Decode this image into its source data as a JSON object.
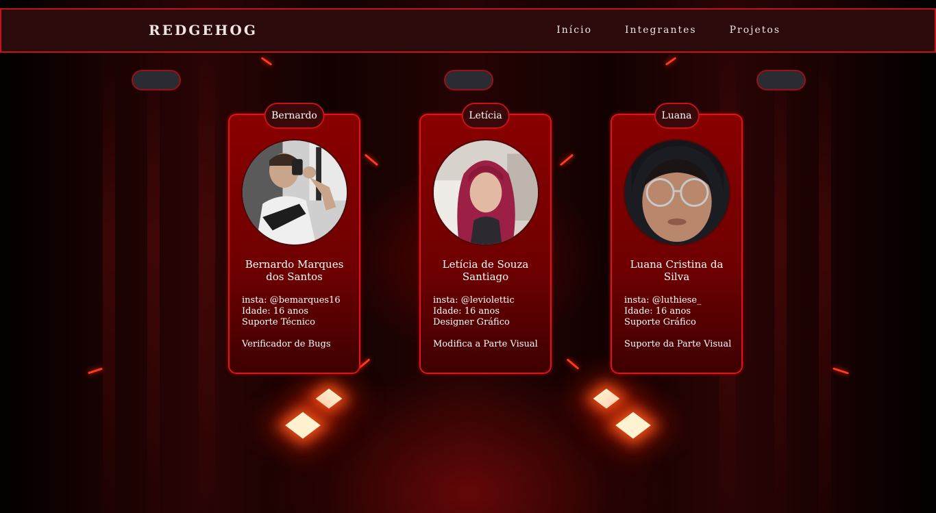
{
  "header": {
    "logo": "REDGEHOG",
    "nav": [
      "Início",
      "Integrantes",
      "Projetos"
    ]
  },
  "members": [
    {
      "tag": "Bernardo",
      "name_line1": "Bernardo Marques",
      "name_line2": "dos Santos",
      "insta": "insta: @bemarques16",
      "age": "Idade: 16 anos",
      "role1": "Suporte Técnico",
      "role2": "Verificador de Bugs"
    },
    {
      "tag": "Letícia",
      "name_line1": "Letícia de Souza",
      "name_line2": "Santiago",
      "insta": "insta: @leviolettic",
      "age": "Idade: 16 anos",
      "role1": "Designer Gráfico",
      "role2": "Modifica a Parte Visual"
    },
    {
      "tag": "Luana",
      "name_line1": "Luana Cristina da",
      "name_line2": "Silva",
      "insta": "insta: @luthiese_",
      "age": "Idade: 16 anos",
      "role1": "Suporte Gráfico",
      "role2": "Suporte da Parte Visual"
    }
  ],
  "colors": {
    "accent": "#c4131a",
    "card_bg": "#7a0000",
    "header_bg": "#2a0a0a",
    "pill_bg": "#2b2b33"
  }
}
